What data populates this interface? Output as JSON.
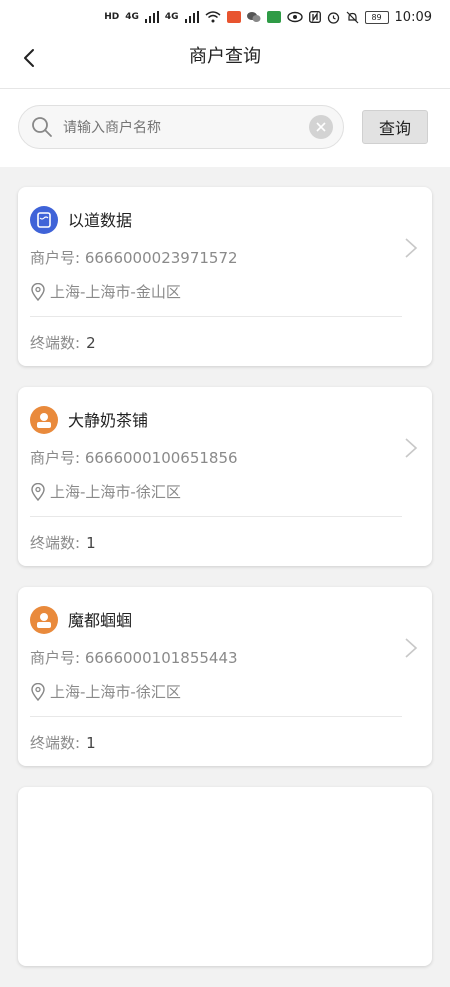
{
  "status_bar": {
    "network_hd": "HD",
    "network_4g_1": "4G",
    "network_4g_2": "4G",
    "battery": "89",
    "time": "10:09"
  },
  "header": {
    "title": "商户查询"
  },
  "search": {
    "placeholder": "请输入商户名称",
    "value": "",
    "query_label": "查询"
  },
  "labels": {
    "merchant_no": "商户号:",
    "terminal_count": "终端数:"
  },
  "merchants": [
    {
      "name": "以道数据",
      "merchant_no": "6666000023971572",
      "location": "上海-上海市-金山区",
      "terminal_count": "2",
      "avatar": "doc-icon"
    },
    {
      "name": "大静奶茶铺",
      "merchant_no": "6666000100651856",
      "location": "上海-上海市-徐汇区",
      "terminal_count": "1",
      "avatar": "person-icon"
    },
    {
      "name": "魔都蝈蝈",
      "merchant_no": "6666000101855443",
      "location": "上海-上海市-徐汇区",
      "terminal_count": "1",
      "avatar": "person-icon"
    }
  ],
  "colors": {
    "avatar_blue": "#3f63d8",
    "avatar_orange": "#e98a3c"
  }
}
